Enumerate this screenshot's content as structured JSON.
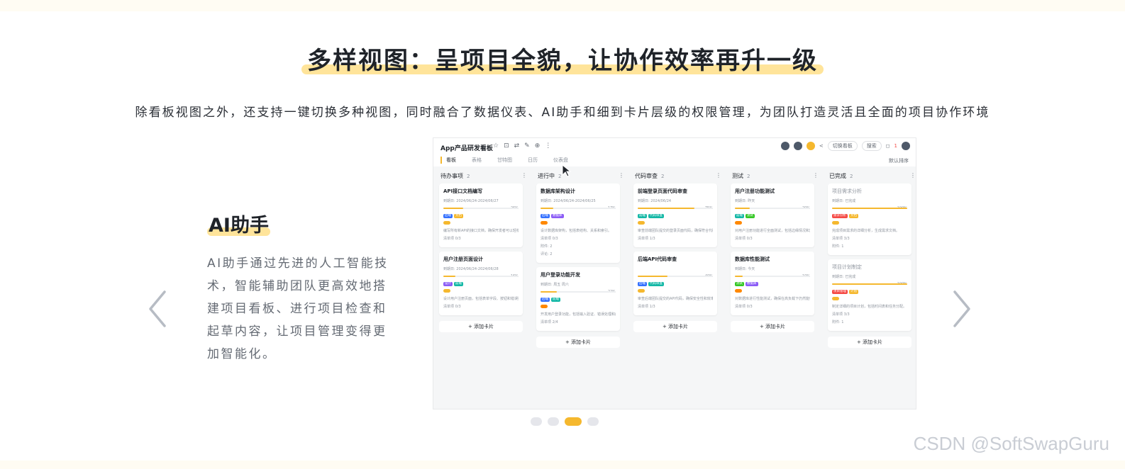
{
  "heading": {
    "title": "多样视图：呈项目全貌，让协作效率再升一级",
    "subtitle": "除看板视图之外，还支持一键切换多种视图，同时融合了数据仪表、AI助手和细到卡片层级的权限管理，为团队打造灵活且全面的项目协作环境"
  },
  "feature": {
    "title": "AI助手",
    "description": "AI助手通过先进的人工智能技术，智能辅助团队更高效地搭建项目看板、进行项目检查和起草内容，让项目管理变得更加智能化。"
  },
  "carousel": {
    "prev_icon": "chevron-left-icon",
    "next_icon": "chevron-right-icon",
    "dots": 4,
    "active_index": 2
  },
  "screenshot": {
    "board_title": "App产品研发看板",
    "actions": {
      "switch_board": "切换看板",
      "search": "搜索",
      "notifications": "1"
    },
    "tabs": [
      "看板",
      "表格",
      "甘特图",
      "日历",
      "仪表盘"
    ],
    "sort": "默认排序",
    "add_card": "+ 添加卡片",
    "columns": [
      {
        "name": "待办事项",
        "count": "2",
        "cards": [
          {
            "title": "API接口文档编写",
            "date": "到期日: 2024/06/24-2024/06/27",
            "progress": 26,
            "progress_label": "26%",
            "tags": [
              "后端",
              "文档"
            ],
            "desc": "编写所有新API的接口文档，确保开发者可以轻松使用。",
            "checklist": "清单项 0/3"
          },
          {
            "title": "用户注册页面设计",
            "date": "到期日: 2024/06/24-2024/06/28",
            "progress": 16,
            "progress_label": "16%",
            "tags": [
              "设计",
              "前端"
            ],
            "desc": "设计用户注册页面，包括表单字段、按钮和错误提示。",
            "checklist": "清单项 0/3"
          }
        ]
      },
      {
        "name": "进行中",
        "count": "2",
        "cards": [
          {
            "title": "数据库架构设计",
            "date": "到期日: 2024/06/24-2024/06/25",
            "progress": 17,
            "progress_label": "17%",
            "tags": [
              "后端",
              "数据库"
            ],
            "desc": "设计数据库架构，包括表结构、关系和索引。",
            "checklist": "清单项 0/3",
            "attachments": "附件: 2",
            "comments": "评论: 2"
          },
          {
            "title": "用户登录功能开发",
            "date": "到期日: 周五 周六",
            "progress": 22,
            "progress_label": "22%",
            "tags": [
              "后端",
              "前端"
            ],
            "desc": "开发用户登录功能，包括输入验证、错误处理和成功登录跳转。",
            "checklist": "清单项 2/4"
          }
        ]
      },
      {
        "name": "代码审查",
        "count": "2",
        "cards": [
          {
            "title": "前端登录页面代码审查",
            "date": "到期日: 2024/06/24",
            "progress": 75,
            "progress_label": "75%",
            "tags": [
              "前端",
              "代码审查"
            ],
            "desc": "审查前端团队提交的登录页面代码，确保符合代码规范和性能要求。",
            "checklist": "清单项 1/3"
          },
          {
            "title": "后端API代码审查",
            "date": "",
            "progress": 40,
            "progress_label": "40%",
            "tags": [
              "后端",
              "代码审查"
            ],
            "desc": "审查后端团队提交的API代码，确保安全性和效率。",
            "checklist": "清单项 1/3"
          }
        ]
      },
      {
        "name": "测试",
        "count": "2",
        "cards": [
          {
            "title": "用户注册功能测试",
            "date": "到期日: 昨天",
            "progress": 20,
            "progress_label": "20%",
            "tags": [
              "前端",
              "测试"
            ],
            "desc": "对用户注册功能进行全面测试，包括边缘情况和异常测试。",
            "checklist": "清单项 0/3"
          },
          {
            "title": "数据库性能测试",
            "date": "到期日: 今天",
            "progress": 10,
            "progress_label": "10%",
            "tags": [
              "测试",
              "数据库"
            ],
            "desc": "对数据库进行性能测试，确保在高负载下仍然能快速响应。",
            "checklist": "清单项 0/3"
          }
        ]
      },
      {
        "name": "已完成",
        "count": "2",
        "cards": [
          {
            "title": "项目需求分析",
            "date": "到期日: 已完成",
            "progress": 100,
            "progress_label": "100%",
            "tags": [
              "需求分析",
              "文档"
            ],
            "desc": "完成项目需求的详细分析，生成需求文档。",
            "checklist": "清单项 3/3",
            "attachments": "附件: 1"
          },
          {
            "title": "项目计划制定",
            "date": "到期日: 已完成",
            "progress": 100,
            "progress_label": "100%",
            "tags": [
              "项目管理",
              "计划"
            ],
            "desc": "制定详细的项目计划，包括时间表和任务分配。",
            "checklist": "清单项 3/3",
            "attachments": "附件: 1"
          }
        ]
      }
    ]
  },
  "watermark": "CSDN @SoftSwapGuru",
  "colors": {
    "accent": "#f5b82e",
    "highlight": "#ffe49a",
    "text": "#1f2329",
    "muted": "#646a73"
  }
}
